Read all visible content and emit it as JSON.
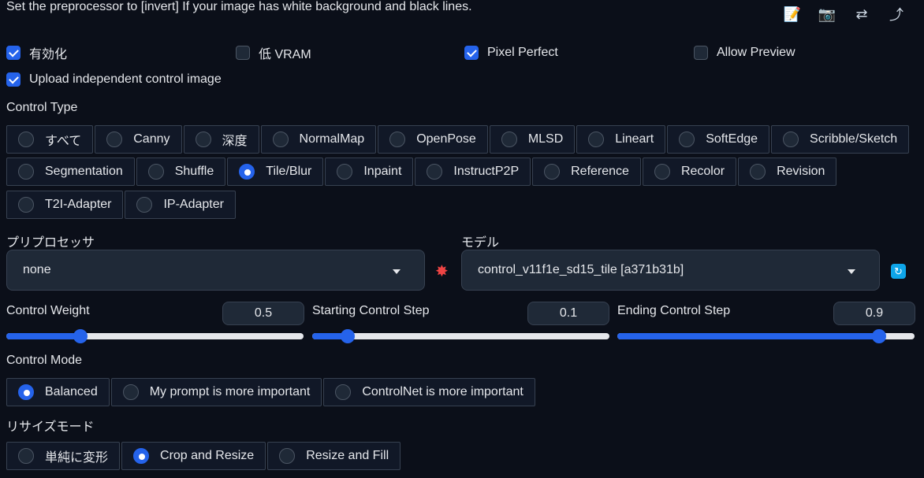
{
  "hint": "Set the preprocessor to [invert] If your image has white background and black lines.",
  "toolbar": {
    "icons": [
      "edit-icon",
      "camera-icon",
      "swap-icon",
      "curve-arrow-icon"
    ],
    "glyphs": {
      "edit": "📝",
      "camera": "📷",
      "swap": "⇄",
      "curve": "⤴"
    }
  },
  "checkboxes": {
    "enable": {
      "label": "有効化",
      "checked": true
    },
    "low_vram": {
      "label": "低 VRAM",
      "checked": false
    },
    "pixel_perfect": {
      "label": "Pixel Perfect",
      "checked": true
    },
    "allow_preview": {
      "label": "Allow Preview",
      "checked": false
    },
    "upload_independent": {
      "label": "Upload independent control image",
      "checked": true
    }
  },
  "control_type": {
    "label": "Control Type",
    "rows": [
      [
        "すべて",
        "Canny",
        "深度",
        "NormalMap",
        "OpenPose",
        "MLSD",
        "Lineart",
        "SoftEdge",
        "Scribble/Sketch"
      ],
      [
        "Segmentation",
        "Shuffle",
        "Tile/Blur",
        "Inpaint",
        "InstructP2P",
        "Reference",
        "Recolor",
        "Revision"
      ],
      [
        "T2I-Adapter",
        "IP-Adapter"
      ]
    ],
    "selected": "Tile/Blur"
  },
  "preprocessor": {
    "label": "プリプロセッサ",
    "value": "none"
  },
  "model": {
    "label": "モデル",
    "value": "control_v11f1e_sd15_tile [a371b31b]"
  },
  "sliders": {
    "weight": {
      "label": "Control Weight",
      "value": "0.5",
      "fraction": 0.25
    },
    "start": {
      "label": "Starting Control Step",
      "value": "0.1",
      "fraction": 0.12
    },
    "end": {
      "label": "Ending Control Step",
      "value": "0.9",
      "fraction": 0.88
    }
  },
  "control_mode": {
    "label": "Control Mode",
    "options": [
      "Balanced",
      "My prompt is more important",
      "ControlNet is more important"
    ],
    "selected": "Balanced"
  },
  "resize_mode": {
    "label": "リサイズモード",
    "options": [
      "単純に変形",
      "Crop and Resize",
      "Resize and Fill"
    ],
    "selected": "Crop and Resize"
  },
  "colors": {
    "accent": "#2563eb",
    "bg": "#0b0f19"
  }
}
